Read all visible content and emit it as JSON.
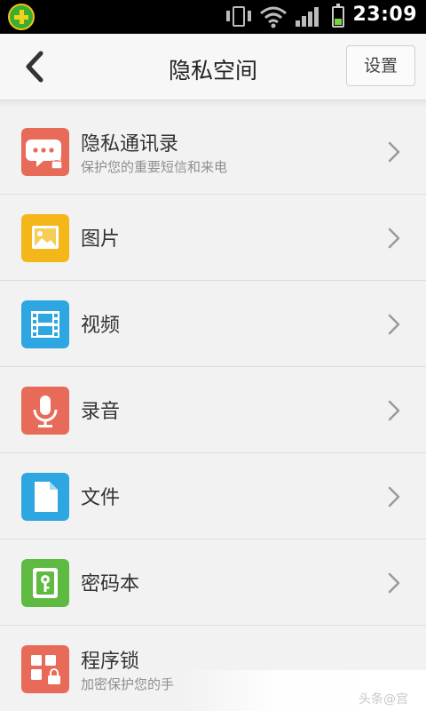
{
  "status_bar": {
    "time": "23:09",
    "battery_level": 0.4,
    "colors": {
      "background": "#000000",
      "battery": "#7bd53a"
    }
  },
  "header": {
    "title": "隐私空间",
    "settings_label": "设置",
    "back_icon": "chevron-left-icon"
  },
  "items": [
    {
      "title": "隐私通讯录",
      "subtitle": "保护您的重要短信和来电",
      "icon": "contacts-lock-icon",
      "color": "#e86a58"
    },
    {
      "title": "图片",
      "icon": "image-icon",
      "color": "#f5b619"
    },
    {
      "title": "视频",
      "icon": "film-icon",
      "color": "#2ea6e1"
    },
    {
      "title": "录音",
      "icon": "microphone-icon",
      "color": "#e86a58"
    },
    {
      "title": "文件",
      "icon": "file-icon",
      "color": "#2ea6e1"
    },
    {
      "title": "密码本",
      "icon": "key-book-icon",
      "color": "#5fba42"
    },
    {
      "title": "程序锁",
      "subtitle": "加密保护您的手",
      "icon": "app-lock-icon",
      "color": "#e86a58"
    }
  ],
  "watermark": "头条@宫"
}
